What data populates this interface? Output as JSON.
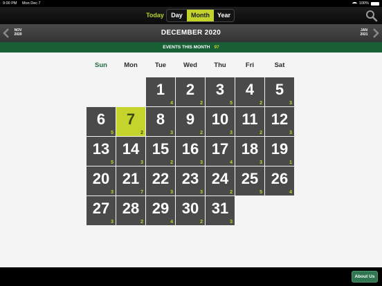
{
  "status": {
    "time": "9:00 PM",
    "date": "Mon Dec 7",
    "battery": "100%"
  },
  "toolbar": {
    "today_label": "Today",
    "day_label": "Day",
    "month_label": "Month",
    "year_label": "Year"
  },
  "nav": {
    "prev_month": "NOV",
    "prev_year": "2020",
    "title": "DECEMBER 2020",
    "next_month": "JAN",
    "next_year": "2021"
  },
  "events": {
    "label": "EVENTS THIS MONTH",
    "count": "97"
  },
  "weekdays": [
    "Sun",
    "Mon",
    "Tue",
    "Wed",
    "Thu",
    "Fri",
    "Sat"
  ],
  "calendar": {
    "first_weekday": 2,
    "today": 7,
    "days": [
      {
        "day": "1",
        "count": "4"
      },
      {
        "day": "2",
        "count": "2"
      },
      {
        "day": "3",
        "count": "5"
      },
      {
        "day": "4",
        "count": "2"
      },
      {
        "day": "5",
        "count": "3"
      },
      {
        "day": "6",
        "count": "5"
      },
      {
        "day": "7",
        "count": "2"
      },
      {
        "day": "8",
        "count": "3"
      },
      {
        "day": "9",
        "count": "2"
      },
      {
        "day": "10",
        "count": "3"
      },
      {
        "day": "11",
        "count": "2"
      },
      {
        "day": "12",
        "count": "3"
      },
      {
        "day": "13",
        "count": "5"
      },
      {
        "day": "14",
        "count": "3"
      },
      {
        "day": "15",
        "count": "2"
      },
      {
        "day": "16",
        "count": "3"
      },
      {
        "day": "17",
        "count": "4"
      },
      {
        "day": "18",
        "count": "3"
      },
      {
        "day": "19",
        "count": "1"
      },
      {
        "day": "20",
        "count": "3"
      },
      {
        "day": "21",
        "count": "7"
      },
      {
        "day": "22",
        "count": "3"
      },
      {
        "day": "23",
        "count": "3"
      },
      {
        "day": "24",
        "count": "2"
      },
      {
        "day": "25",
        "count": "5"
      },
      {
        "day": "26",
        "count": "4"
      },
      {
        "day": "27",
        "count": "3"
      },
      {
        "day": "28",
        "count": "2"
      },
      {
        "day": "29",
        "count": "4"
      },
      {
        "day": "30",
        "count": "2"
      },
      {
        "day": "31",
        "count": "3"
      }
    ]
  },
  "footer": {
    "about_label": "About Us"
  },
  "colors": {
    "accent": "#c4d42d",
    "green": "#185f36",
    "cell": "#4a4a4a"
  }
}
